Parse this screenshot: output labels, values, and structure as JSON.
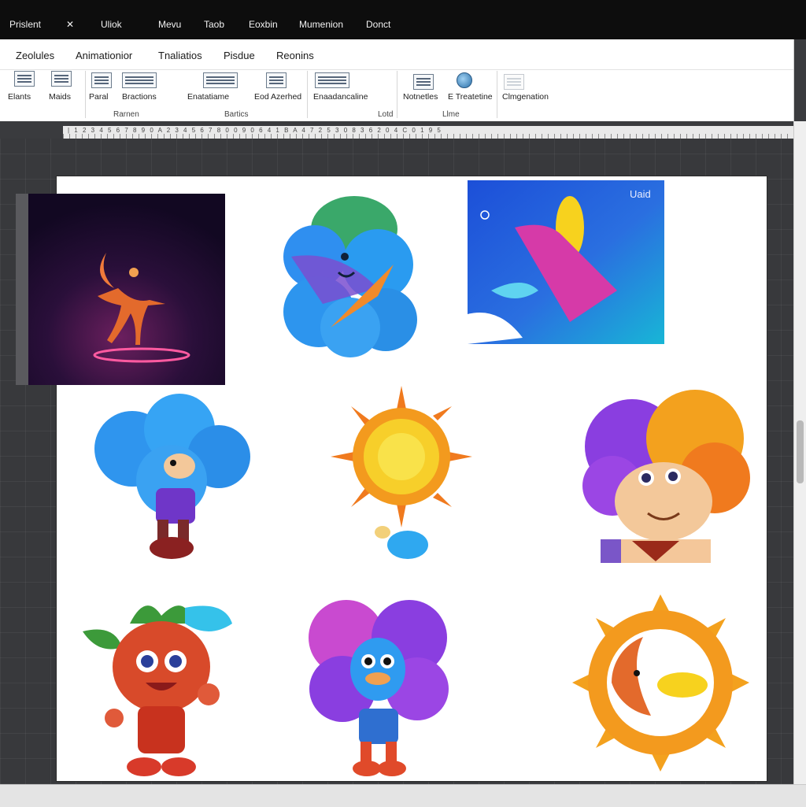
{
  "menubar": {
    "items": [
      "Prislent",
      "✕",
      "Uliok",
      "Mevu",
      "Taob",
      "Eoxbin",
      "Mumenion",
      "Donct"
    ]
  },
  "ribbon": {
    "tabs": [
      "Zeolules",
      "Animationior",
      "Tnaliatios",
      "Pisdue",
      "Reonins"
    ],
    "buttons": [
      "Elants",
      "Maids",
      "Paral",
      "Bractions",
      "Enatatiame",
      "Eod Azerhed",
      "Enaadancaline",
      "Notnetles",
      "E Treatetine",
      "Clmgenation"
    ],
    "groups": [
      "Rarnen",
      "Bartics",
      "Lotd",
      "Llme"
    ]
  },
  "ruler": {
    "text": "| 1 2 3 4 5 6 7 8 9 0 A 2 3 4 5 6 7 8 0 0 9 0 6 4 1 B A 4 7 2 5 3 0 8 3 6 2 0 4 C 0 1 9 5"
  },
  "canvas": {
    "tiles": [
      {
        "id": "dancer-glow",
        "label": ""
      },
      {
        "id": "blue-cloud-bird",
        "label": ""
      },
      {
        "id": "gradient-banner",
        "label": "Uaid"
      },
      {
        "id": "cloud-kid",
        "label": ""
      },
      {
        "id": "sun-character",
        "label": ""
      },
      {
        "id": "flower-lion",
        "label": ""
      },
      {
        "id": "strawberry-kid",
        "label": ""
      },
      {
        "id": "purple-flower-kid",
        "label": ""
      },
      {
        "id": "sun-ring",
        "label": ""
      }
    ]
  },
  "colors": {
    "menubar_bg": "#0d0d0d",
    "workspace_bg": "#38393c",
    "page_bg": "#ffffff",
    "accent_blue": "#2f8ff0",
    "accent_orange": "#f39a1e",
    "accent_purple": "#8a3ee0"
  },
  "icons": [
    "close-icon",
    "globe-icon",
    "toolbar-icon"
  ]
}
